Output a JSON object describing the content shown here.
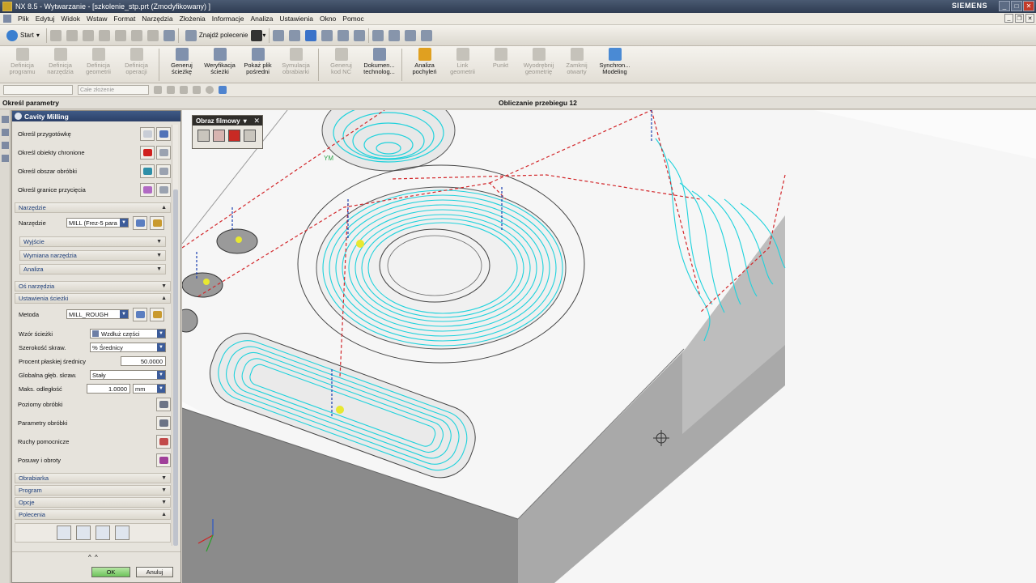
{
  "window": {
    "title": "NX 8.5 - Wytwarzanie - [szkolenie_stp.prt (Zmodyfikowany) ]",
    "brand": "SIEMENS"
  },
  "menu": [
    "Plik",
    "Edytuj",
    "Widok",
    "Wstaw",
    "Format",
    "Narzędzia",
    "Złożenia",
    "Informacje",
    "Analiza",
    "Ustawienia",
    "Okno",
    "Pomoc"
  ],
  "toolbar": {
    "start_label": "Start",
    "find_command_label": "Znajdź polecenie"
  },
  "ribbon": [
    {
      "line1": "Definicja",
      "line2": "programu"
    },
    {
      "line1": "Definicja",
      "line2": "narzędzia"
    },
    {
      "line1": "Definicja",
      "line2": "geometrii"
    },
    {
      "line1": "Definicja",
      "line2": "operacji"
    },
    {
      "line1": "Generuj",
      "line2": "ścieżkę"
    },
    {
      "line1": "Weryfikacja",
      "line2": "ścieżki"
    },
    {
      "line1": "Pokaż plik",
      "line2": "pośredni"
    },
    {
      "line1": "Symulacja",
      "line2": "obrabiarki"
    },
    {
      "line1": "Generuj",
      "line2": "kod NC"
    },
    {
      "line1": "Dokumen...",
      "line2": "technolog..."
    },
    {
      "line1": "Analiza",
      "line2": "pochyleń"
    },
    {
      "line1": "Link",
      "line2": "geometrii"
    },
    {
      "line1": "Punkt",
      "line2": ""
    },
    {
      "line1": "Wyodrębnij",
      "line2": "geometrię"
    },
    {
      "line1": "Zamknij",
      "line2": "otwarty"
    },
    {
      "line1": "Synchron...",
      "line2": "Modeling"
    }
  ],
  "toolbar3": {
    "assembly_placeholder": "Całe złożenie"
  },
  "status": {
    "left": "Określ parametry",
    "right": "Obliczanie przebiegu 12"
  },
  "dialog": {
    "title": "Cavity Milling",
    "geometry_rows": [
      "Określ przygotówkę",
      "Określ obiekty chronione",
      "Określ obszar obróbki",
      "Określ granice przycięcia"
    ],
    "tool_group": "Narzędzie",
    "tool_label": "Narzędzie",
    "tool_value": "MILL (Frez-5 para",
    "sub_groups": [
      "Wyjście",
      "Wymiana narzędzia",
      "Analiza"
    ],
    "axis_group": "Oś narzędzia",
    "path_group": "Ustawienia ścieżki",
    "method_label": "Metoda",
    "method_value": "MILL_ROUGH",
    "pattern_label": "Wzór ścieżki",
    "pattern_value": "Wzdłuż części",
    "width_label": "Szerokość skraw.",
    "width_value": "% Średnicy",
    "flat_pct_label": "Procent płaskiej średnicy",
    "flat_pct_value": "50.0000",
    "depth_label": "Globalna głęb. skraw.",
    "depth_value": "Stały",
    "max_dist_label": "Maks. odległość",
    "max_dist_value": "1.0000",
    "max_dist_unit": "mm",
    "button_rows": [
      "Poziomy obróbki",
      "Parametry obróbki",
      "Ruchy pomocnicze",
      "Posuwy i obroty"
    ],
    "bottom_groups": [
      "Obrabiarka",
      "Program",
      "Opcje",
      "Polecenia"
    ],
    "ok_label": "OK",
    "cancel_label": "Anuluj"
  },
  "film_dialog": {
    "title": "Obraz filmowy"
  },
  "viewport": {
    "csys_label": "YM",
    "toolpath_color": "#1fd2dc",
    "rapid_color": "#d2262a"
  }
}
